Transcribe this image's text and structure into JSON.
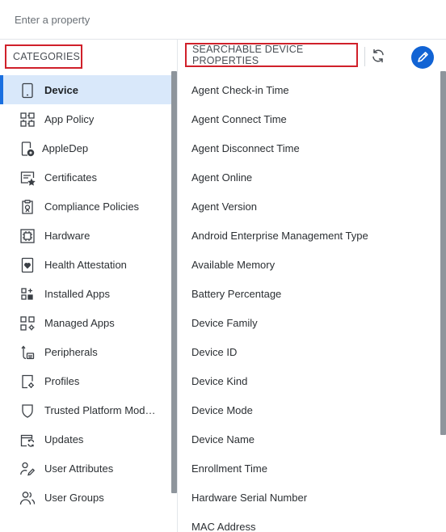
{
  "search": {
    "placeholder": "Enter a property",
    "value": ""
  },
  "categories": {
    "header": "CATEGORIES",
    "items": [
      {
        "label": "Device",
        "icon": "device-icon",
        "active": true
      },
      {
        "label": "App Policy",
        "icon": "app-policy-icon"
      },
      {
        "label": "AppleDep",
        "icon": "appledep-icon"
      },
      {
        "label": "Certificates",
        "icon": "certificate-icon"
      },
      {
        "label": "Compliance Policies",
        "icon": "compliance-icon"
      },
      {
        "label": "Hardware",
        "icon": "chip-icon"
      },
      {
        "label": "Health Attestation",
        "icon": "health-icon"
      },
      {
        "label": "Installed Apps",
        "icon": "installed-apps-icon"
      },
      {
        "label": "Managed Apps",
        "icon": "managed-apps-icon"
      },
      {
        "label": "Peripherals",
        "icon": "peripherals-icon"
      },
      {
        "label": "Profiles",
        "icon": "profiles-icon"
      },
      {
        "label": "Trusted Platform Mod…",
        "icon": "shield-icon"
      },
      {
        "label": "Updates",
        "icon": "updates-icon"
      },
      {
        "label": "User Attributes",
        "icon": "user-attributes-icon"
      },
      {
        "label": "User Groups",
        "icon": "user-groups-icon"
      }
    ]
  },
  "properties": {
    "header": "SEARCHABLE DEVICE PROPERTIES",
    "items": [
      "Agent Check-in Time",
      "Agent Connect Time",
      "Agent Disconnect Time",
      "Agent Online",
      "Agent Version",
      "Android Enterprise Management Type",
      "Available Memory",
      "Battery Percentage",
      "Device Family",
      "Device ID",
      "Device Kind",
      "Device Mode",
      "Device Name",
      "Enrollment Time",
      "Hardware Serial Number",
      "MAC Address"
    ]
  },
  "colors": {
    "accent": "#1163d4",
    "active_bg": "#d9e8fa",
    "highlight_border": "#d0202a"
  }
}
